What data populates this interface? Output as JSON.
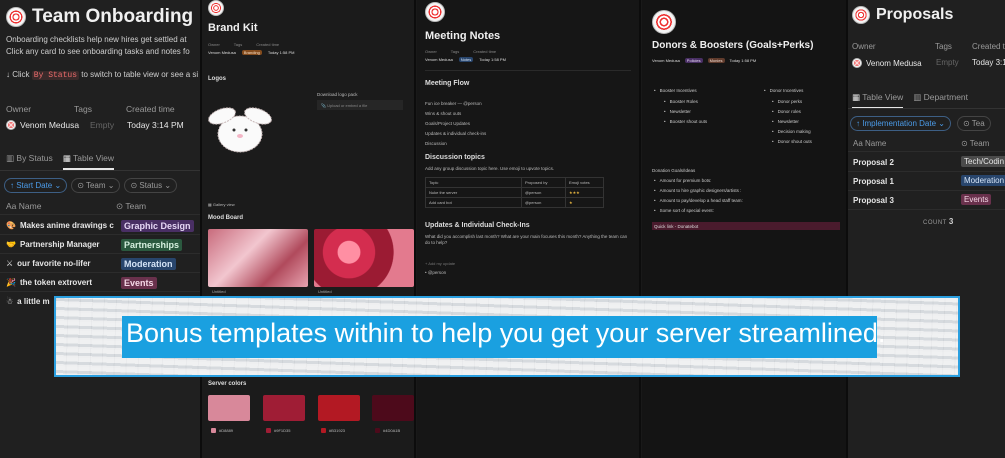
{
  "onboarding": {
    "title": "Team Onboarding",
    "description_line1": "Onboarding checklists help new hires get settled at",
    "description_line2": "Click any card to see onboarding tasks and notes fo",
    "tip_prefix": "↓ Click",
    "tip_code": "By Status",
    "tip_suffix": "to switch to table view or see a si",
    "owner_label": "Owner",
    "tags_label": "Tags",
    "created_label": "Created time",
    "owner_value": "Venom Medusa",
    "tags_value": "Empty",
    "created_value": "Today 3:14 PM",
    "tab_by_status": "By Status",
    "tab_table_view": "Table View",
    "filter_start_date": "↑ Start Date",
    "filter_team": "Team",
    "filter_status": "Status",
    "col_name": "Aa Name",
    "col_team": "Team",
    "rows": [
      {
        "name": "Makes anime drawings c",
        "team": "Graphic Design"
      },
      {
        "name": "Partnership Manager",
        "team": "Partnerships"
      },
      {
        "name": "our favorite no-lifer",
        "team": "Moderation"
      },
      {
        "name": "the token extrovert",
        "team": "Events"
      },
      {
        "name": "a little m",
        "team": ""
      }
    ]
  },
  "brand_kit": {
    "title": "Brand Kit",
    "owner_label": "Owner",
    "tags_label": "Tags",
    "created_label": "Created time",
    "owner_value": "Venom Medusa",
    "tags_value": "Branding",
    "created_value": "Today 1:58 PM",
    "logos_heading": "Logos",
    "download_label": "Download logo pack",
    "upload_placeholder": "Upload or embed a file",
    "gallery_view": "Gallery view",
    "mood_board_heading": "Mood Board",
    "caption1": "Untitled",
    "caption2": "Untitled",
    "server_colors_heading": "Server colors",
    "swatches": [
      {
        "hex": "#D8889A",
        "label": "#D8889"
      },
      {
        "hex": "#9F1D35",
        "label": "#9F1D35"
      },
      {
        "hex": "#B31923",
        "label": "#B31923"
      },
      {
        "hex": "#4D0A1B",
        "label": "#4D0A1B"
      }
    ]
  },
  "meeting_notes": {
    "title": "Meeting Notes",
    "owner_label": "Owner",
    "tags_label": "Tags",
    "created_label": "Created time",
    "owner_value": "Venom Medusa",
    "tags_value": "Notes",
    "created_value": "Today 1:58 PM",
    "flow_heading": "Meeting Flow",
    "flow_items": [
      "Fun ice breaker — @person",
      "Wins & shout outs",
      "Goals/Project Updates",
      "Updates & individual check-ins",
      "Discussion"
    ],
    "topics_heading": "Discussion topics",
    "topics_desc": "Add any group discussion topic here. Use emoji to upvote topics.",
    "table_header": [
      "Topic",
      "Proposed by",
      "Emoji votes"
    ],
    "table_rows": [
      [
        "Nuke the server",
        "@person",
        "★★★"
      ],
      [
        "Add card bot",
        "@person",
        "★"
      ]
    ],
    "updates_heading": "Updates & Individual Check-Ins",
    "updates_desc": "What did you accomplish last month? What are your main focuses this month? Anything the team can do to help?",
    "add_update": "+ Add my update",
    "person": "@person"
  },
  "donors": {
    "title": "Donors & Boosters (Goals+Perks)",
    "owner_value": "Venom Medusa",
    "tag1": "Policies",
    "tag2": "Monies",
    "created_value": "Today 1:58 PM",
    "left_col": [
      "Booster Incentives",
      "Booster Roles",
      "Newsletter",
      "Booster shout outs"
    ],
    "right_col": [
      "Donor Incentives",
      "Donor perks",
      "Donor roles",
      "Newsletter",
      "Decision making",
      "Donor shout outs"
    ],
    "goals_heading": "Donation Goals/Ideas",
    "goals": [
      "Amount for premium bots:",
      "Amount to hire graphic designers/artists :",
      "Amount to pay/develop a head staff team:",
      "Some sort of special event:"
    ],
    "quick_link": "Quick link - Donatebot"
  },
  "proposals": {
    "title": "Proposals",
    "owner_label": "Owner",
    "tags_label": "Tags",
    "created_label": "Created t",
    "owner_value": "Venom Medusa",
    "tags_value": "Empty",
    "created_value": "Today 3:1",
    "tab_table_view": "Table View",
    "tab_department": "Department",
    "filter_impl_date": "↑ Implementation Date",
    "filter_team": "Tea",
    "col_name": "Aa Name",
    "col_team": "Team",
    "rows": [
      {
        "name": "Proposal 2",
        "team": "Tech/Codin"
      },
      {
        "name": "Proposal 1",
        "team": "Moderation"
      },
      {
        "name": "Proposal 3",
        "team": "Events"
      }
    ],
    "count_label": "COUNT",
    "count_value": "3"
  },
  "banner": {
    "text": "Bonus templates within to help you get your server streamlined."
  }
}
